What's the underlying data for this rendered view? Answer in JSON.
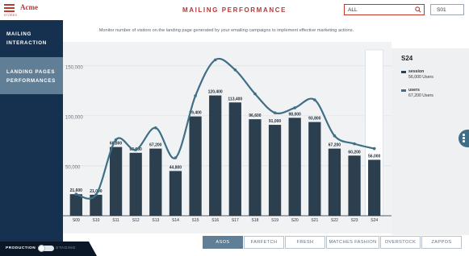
{
  "header": {
    "logo_text": "Acme",
    "logo_subtext": "STORES",
    "title": "MAILING PERFORMANCE",
    "search_value": "ALL",
    "week": "S01"
  },
  "sidebar": {
    "items": [
      {
        "line1": "MAILING",
        "line2": "INTERACTION"
      },
      {
        "line1": "LANDING PAGES",
        "line2": "PERFORMANCES"
      }
    ],
    "env_production": "PRODUCTION",
    "env_staging": "STAGING"
  },
  "main": {
    "subtitle": "Monitor number of visitors on the landing page generated by your emailing campaigns to implement effective marketing actions."
  },
  "panel": {
    "week": "S24",
    "legend": [
      {
        "name": "session",
        "value": "56,000 Users",
        "color": "#2b3f4f"
      },
      {
        "name": "users",
        "value": "67,200 Users",
        "color": "#3f6f86"
      }
    ]
  },
  "tabs": [
    "ASOS",
    "FARFETCH",
    "FRESH",
    "MATCHES FASHION",
    "OVERSTOCK",
    "ZAPPOS"
  ],
  "active_tab": "ASOS",
  "chart_data": {
    "type": "bar",
    "categories": [
      "S09",
      "S10",
      "S11",
      "S12",
      "S13",
      "S14",
      "S15",
      "S16",
      "S17",
      "S18",
      "S19",
      "S20",
      "S21",
      "S22",
      "S23",
      "S24"
    ],
    "series": [
      {
        "name": "session",
        "values": [
          21600,
          21000,
          68800,
          63000,
          67200,
          44800,
          99400,
          120400,
          113400,
          96600,
          91000,
          98000,
          93800,
          67200,
          60200,
          56000
        ],
        "type": "bar",
        "color": "#2b3f4f"
      },
      {
        "name": "users",
        "values": [
          21600,
          21000,
          76000,
          66000,
          88000,
          58000,
          120000,
          156000,
          146000,
          122000,
          103000,
          108000,
          116000,
          80000,
          72000,
          67200
        ],
        "type": "line",
        "color": "#3f6f86"
      }
    ],
    "y_ticks": [
      "150,000",
      "100,000",
      "50,000"
    ],
    "ylim": [
      0,
      170000
    ],
    "highlight_category": "S24"
  }
}
